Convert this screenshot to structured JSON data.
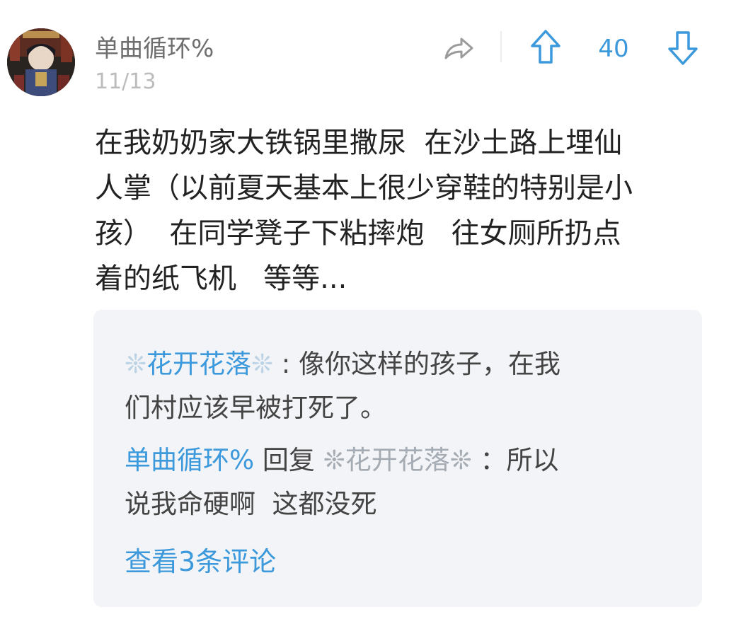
{
  "post": {
    "author": "单曲循环%",
    "date": "11/13",
    "votes": "40",
    "text_lines": [
      "在我奶奶家大铁锅里撒尿  在沙土路上埋仙",
      "人掌（以前夏天基本上很少穿鞋的特别是小",
      "孩）  在同学凳子下粘摔炮   往女厕所扔点",
      "着的纸飞机   等等..."
    ]
  },
  "actions": {
    "share_icon": "share-arrow-icon",
    "upvote_icon": "arrow-up-icon",
    "downvote_icon": "arrow-down-icon"
  },
  "replies": {
    "first": {
      "deco_left": "❊",
      "name": "花开花落",
      "deco_right": "❊",
      "sep": " : ",
      "text_part1": "像你这样的孩子，在我",
      "text_part2": "们村应该早被打死了。"
    },
    "second": {
      "author": "单曲循环%",
      "reply_word": " 回复 ",
      "deco_left": "❊",
      "target": "花开花落",
      "deco_right": "❊",
      "sep": " ：",
      "text_part1": "所以",
      "text_part2": "说我命硬啊  这都没死"
    },
    "view_more": "查看3条评论"
  },
  "colors": {
    "accent": "#3c99db",
    "muted": "#a5abb3",
    "reply_bg": "#f3f4f7"
  }
}
